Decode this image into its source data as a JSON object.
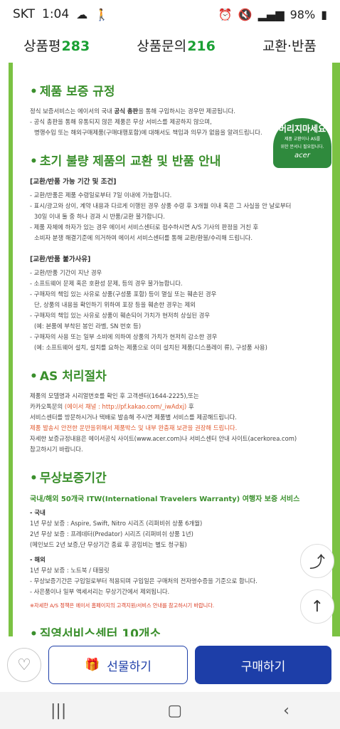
{
  "status": {
    "carrier": "SKT",
    "time": "1:04",
    "battery": "98%"
  },
  "tabs": [
    {
      "label": "상품평",
      "count": "283"
    },
    {
      "label": "상품문의",
      "count": "216"
    },
    {
      "label": "교환·반품",
      "count": ""
    }
  ],
  "badge": {
    "title": "버리지마세요",
    "line1": "제품 교환이나 AS를",
    "line2": "위한 문서니 필요합니다.",
    "brand": "acer"
  },
  "s1": {
    "title": "제품 보증 규정",
    "p1a": "정식 보증서비스는 에이서의 국내 ",
    "p1b": "공식 총판",
    "p1c": "을 통해 구입하시는 경우만 제공됩니다.",
    "p2": "- 공식 총판을 통해 유통되지 않은 제품은 무상 서비스를 제공하지 않으며,",
    "p3": "병행수입 또는 해외구매제품(구매대행포함)에 대해서도 책임과 의무가 없음을 알려드립니다."
  },
  "s2": {
    "title": "초기 불량 제품의 교환 및 반품 안내",
    "sub1": "[교환/반품 가능 기간 및 조건]",
    "a1": "- 교환/반품은 제품 수령일로부터 7일 이내에 가능합니다.",
    "a2": "- 표시/광고와 상이, 계약 내용과 다르게 이행된 경우 상품 수령 후 3개월 이내 혹은 그 사실을 안 날로부터",
    "a3": "30일 이내 둘 중 하나 경과 시 반품/교환 불가합니다.",
    "a4": "- 제품 자체에 하자가 있는 경우 에이서 서비스센터로 접수하시면 A/S 기사의 판정을 거친 후",
    "a5": "소비자 분쟁 해결기준에 의거하여 에이서 서비스센터를 통해 교환/환불/수리해 드립니다.",
    "sub2": "[교환/반품 불가사유]",
    "b1": "- 교환/반품 기간이 지난 경우",
    "b2": "- 소프트웨어 문제 혹은 호환성 문제, 등의 경우 불가능합니다.",
    "b3": "- 구매자의 책임 있는 사유로 상품(구성품 포함) 등이 멸실 또는 훼손된 경우",
    "b4": "단, 상품의 내용을 확인하기 위하여 포장 등을 훼손한 경우는 제외",
    "b5": "- 구매자의 책임 있는 사유로 상품이 훼손되어 가치가 현저히 상실된 경우",
    "b6": "(예: 본품에 부착된 봉인 라벨, SN 번호 등)",
    "b7": "- 구매자의 사용 또는 일부 소비에 의하여 상품의 가치가 현저히 감소한 경우",
    "b8": "(예: 소프트웨어 설치, 설치를 요하는 제품으로 이미 설치된 제품(디스플레이 류), 구성품 사용)"
  },
  "s3": {
    "title": "AS 처리절차",
    "c1": "제품의 모델명과 시리얼번호를 확인 후 고객센터(1644-2225),또는",
    "c2a": "카카오톡문의 ",
    "c2b": "(에이서 채널 : http://pf.kakao.com/_iwAdxj)",
    "c2c": " 후",
    "c3": "서비스센터를 방문하시거나 택배로 발송해 주시면 제품별 서비스를 제공해드립니다.",
    "c4": "제품 발송시 안전한 운반을위해서 제품박스 및 내부 완충재 보관을 권장해 드립니다.",
    "c5": "자세한 보증규정내용은 에이서공식 사이트(www.acer.com)나 서비스센터 안내 사이트(acerkorea.com)",
    "c6": "참고하시기 바랍니다."
  },
  "s4": {
    "title": "무상보증기간",
    "service": "국내/해외 50개국 ITW(International Travelers Warranty) 여행자 보증 서비스",
    "dom": "- 국내",
    "d1": "1년 무상 보증 : Aspire, Swift, Nitro 시리즈 (리퍼비쉬 상품 6개월)",
    "d2": "2년 무상 보증 : 프레데터(Predator) 시리즈 (리퍼비쉬 상품 1년)",
    "d3": "(메인보드 2년 보증,단 무상기간 종료 후 공임비는 별도 청구됨)",
    "abr": "- 해외",
    "o1": "1년 무상 보증 : 노트북 / 태블릿",
    "o2": "- 무상보증기간은 구입일로부터 적용되며 구입일은 구매처의 전자영수증을 기준으로 합니다.",
    "o3": "- 사은품이나 일부 액세서리는 무상기간에서 제외됩니다.",
    "note": "※자세한 A/S 정책은 에이서 홈페이지의 고객지원/서비스 안내를 참고하시기 바랍니다."
  },
  "s5": {
    "title": "직영서비스센터 10개소"
  },
  "bottom": {
    "gift": "선물하기",
    "buy": "구매하기"
  }
}
